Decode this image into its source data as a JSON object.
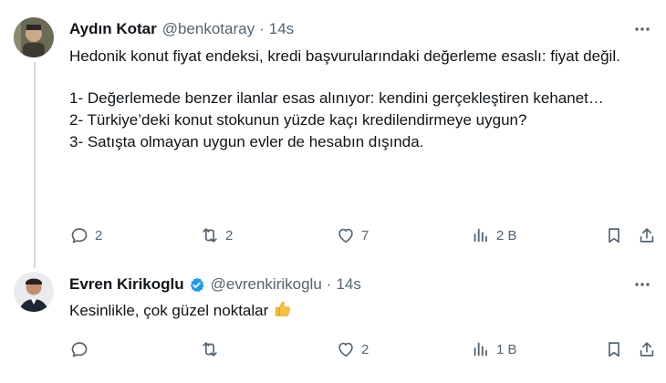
{
  "tweets": [
    {
      "author_name": "Aydın Kotar",
      "handle": "@benkotaray",
      "separator": "·",
      "time": "14s",
      "paragraphs": [
        "Hedonik konut fiyat endeksi, kredi başvurularındaki değerleme esaslı: fiyat değil.",
        "",
        "1- Değerlemede benzer ilanlar esas alınıyor: kendini gerçekleştiren kehanet…",
        "2- Türkiye’deki konut stokunun yüzde kaçı kredilendirmeye uygun?",
        "3- Satışta olmayan uygun evler de hesabın dışında."
      ],
      "replies": "2",
      "retweets": "2",
      "likes": "7",
      "views": "2 B"
    },
    {
      "author_name": "Evren Kirikoglu",
      "handle": "@evrenkirikoglu",
      "separator": "·",
      "time": "14s",
      "text": "Kesinlikle, çok güzel noktalar",
      "emoji": "thumbs-up",
      "replies": "",
      "retweets": "",
      "likes": "2",
      "views": "1 B"
    }
  ],
  "colors": {
    "text": "#0f1419",
    "secondary": "#536471",
    "verified": "#1d9bf0",
    "thread_line": "#cfd9de"
  }
}
